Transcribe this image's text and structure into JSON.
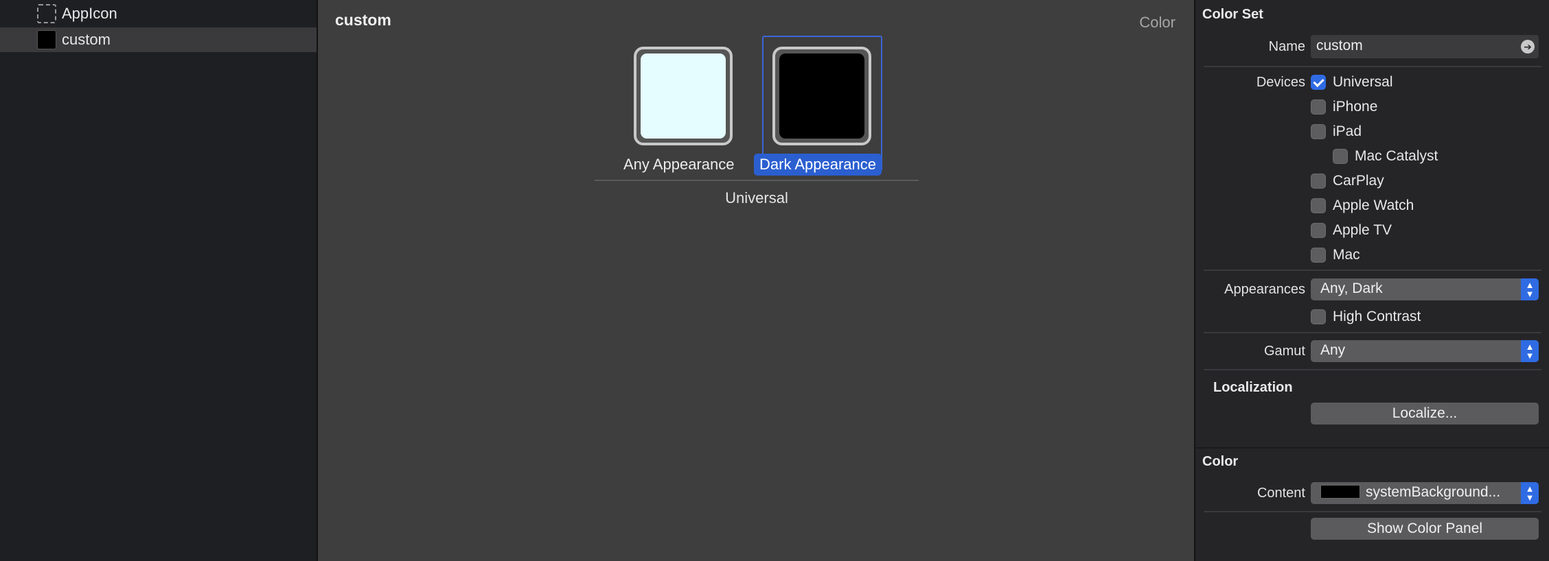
{
  "sidebar": {
    "items": [
      {
        "label": "AppIcon",
        "thumb": "dashed-appicon-icon"
      },
      {
        "label": "custom",
        "thumb": "black-color-swatch"
      }
    ],
    "selected_index": 1
  },
  "editor": {
    "title": "custom",
    "kind": "Color",
    "wells": [
      {
        "label": "Any Appearance",
        "color": "#e6fdff",
        "selected": false
      },
      {
        "label": "Dark Appearance",
        "color": "#000000",
        "selected": true
      }
    ],
    "group_label": "Universal"
  },
  "inspector": {
    "color_set": {
      "title": "Color Set",
      "name_label": "Name",
      "name_value": "custom",
      "devices_label": "Devices",
      "devices": [
        {
          "label": "Universal",
          "checked": true,
          "indent": false
        },
        {
          "label": "iPhone",
          "checked": false,
          "indent": false
        },
        {
          "label": "iPad",
          "checked": false,
          "indent": false
        },
        {
          "label": "Mac Catalyst",
          "checked": false,
          "indent": true
        },
        {
          "label": "CarPlay",
          "checked": false,
          "indent": false
        },
        {
          "label": "Apple Watch",
          "checked": false,
          "indent": false
        },
        {
          "label": "Apple TV",
          "checked": false,
          "indent": false
        },
        {
          "label": "Mac",
          "checked": false,
          "indent": false
        }
      ],
      "appearances_label": "Appearances",
      "appearances_value": "Any, Dark",
      "high_contrast_label": "High Contrast",
      "high_contrast_checked": false,
      "gamut_label": "Gamut",
      "gamut_value": "Any",
      "localization_title": "Localization",
      "localize_button": "Localize..."
    },
    "color": {
      "title": "Color",
      "content_label": "Content",
      "content_value": "systemBackground...",
      "content_chip_color": "#000000",
      "show_panel_button": "Show Color Panel"
    }
  },
  "colors": {
    "accent": "#2f6be3",
    "selection": "#2b5fd0",
    "editor_bg": "#3e3e3e",
    "inspector_bg": "#252528"
  }
}
